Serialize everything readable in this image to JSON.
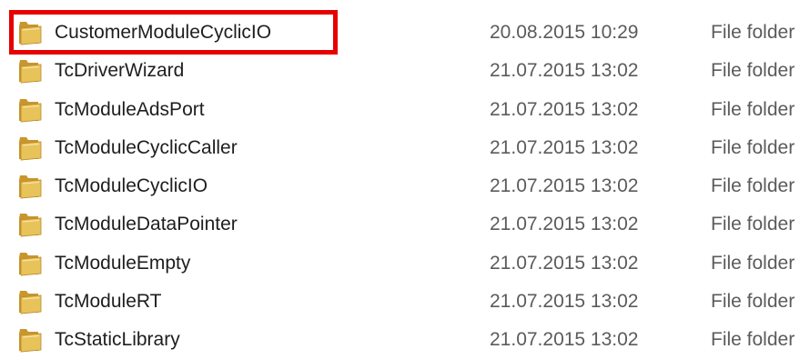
{
  "folders": [
    {
      "name": "CustomerModuleCyclicIO",
      "date_modified": "20.08.2015 10:29",
      "type": "File folder",
      "highlighted": true
    },
    {
      "name": "TcDriverWizard",
      "date_modified": "21.07.2015 13:02",
      "type": "File folder",
      "highlighted": false
    },
    {
      "name": "TcModuleAdsPort",
      "date_modified": "21.07.2015 13:02",
      "type": "File folder",
      "highlighted": false
    },
    {
      "name": "TcModuleCyclicCaller",
      "date_modified": "21.07.2015 13:02",
      "type": "File folder",
      "highlighted": false
    },
    {
      "name": "TcModuleCyclicIO",
      "date_modified": "21.07.2015 13:02",
      "type": "File folder",
      "highlighted": false
    },
    {
      "name": "TcModuleDataPointer",
      "date_modified": "21.07.2015 13:02",
      "type": "File folder",
      "highlighted": false
    },
    {
      "name": "TcModuleEmpty",
      "date_modified": "21.07.2015 13:02",
      "type": "File folder",
      "highlighted": false
    },
    {
      "name": "TcModuleRT",
      "date_modified": "21.07.2015 13:02",
      "type": "File folder",
      "highlighted": false
    },
    {
      "name": "TcStaticLibrary",
      "date_modified": "21.07.2015 13:02",
      "type": "File folder",
      "highlighted": false
    }
  ],
  "icon": "folder-icon",
  "colors": {
    "highlight_border": "#e60000",
    "folder_yellow": "#e8c35a",
    "secondary_text": "#5b5b5b"
  }
}
